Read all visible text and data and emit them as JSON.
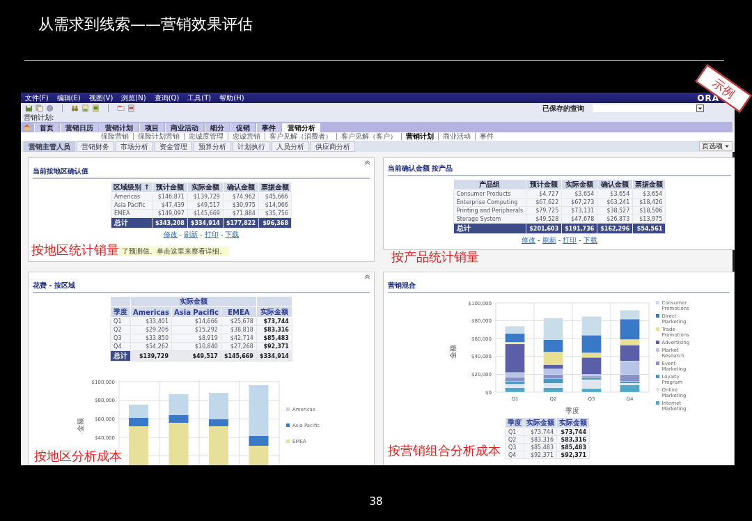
{
  "slide": {
    "title": "从需求到线索——营销效果评估",
    "stamp": "示例",
    "page_number": "38"
  },
  "app": {
    "menu": [
      "文件(F)",
      "编辑(E)",
      "视图(V)",
      "浏览(N)",
      "查询(Q)",
      "工具(T)",
      "帮助(H)"
    ],
    "logo": "ORA",
    "saved_query_label": "已保存的查询",
    "screen_label": "营销计划:",
    "tabs": [
      {
        "label": "首页",
        "selected": false
      },
      {
        "label": "营销日历",
        "selected": false
      },
      {
        "label": "营销计划",
        "selected": false
      },
      {
        "label": "项目",
        "selected": false
      },
      {
        "label": "商业活动",
        "selected": false
      },
      {
        "label": "细分",
        "selected": false
      },
      {
        "label": "促销",
        "selected": false
      },
      {
        "label": "事件",
        "selected": false
      },
      {
        "label": "营销分析",
        "selected": true
      }
    ],
    "subtabs": [
      {
        "label": "保险营销",
        "selected": false
      },
      {
        "label": "保险计划营销",
        "selected": false
      },
      {
        "label": "忠诚度管理",
        "selected": false
      },
      {
        "label": "忠诚营销",
        "selected": false
      },
      {
        "label": "客户见解（消费者）",
        "selected": false
      },
      {
        "label": "客户见解（客户）",
        "selected": false
      },
      {
        "label": "营销计划",
        "selected": true
      },
      {
        "label": "商业活动",
        "selected": false
      },
      {
        "label": "事件",
        "selected": false
      }
    ],
    "view_tabs": [
      {
        "label": "营销主管人员",
        "selected": true
      },
      {
        "label": "营销财务",
        "selected": false
      },
      {
        "label": "市场分析",
        "selected": false
      },
      {
        "label": "资金管理",
        "selected": false
      },
      {
        "label": "预算分析",
        "selected": false
      },
      {
        "label": "计划执行",
        "selected": false
      },
      {
        "label": "人员分析",
        "selected": false
      },
      {
        "label": "供应商分析",
        "selected": false
      }
    ],
    "page_options": "页选项",
    "region_report": {
      "title": "当前按地区确认值",
      "columns": [
        "区域级别 ↑",
        "预计金额",
        "实际金额",
        "确认金额",
        "票据金额"
      ],
      "rows": [
        {
          "kind": "data",
          "cells": [
            "Americas",
            "$146,871",
            "$139,729",
            "$74,962",
            "$45,666"
          ]
        },
        {
          "kind": "data",
          "cells": [
            "Asia Pacific",
            "$47,439",
            "$49,517",
            "$30,975",
            "$14,966"
          ]
        },
        {
          "kind": "data",
          "cells": [
            "EMEA",
            "$149,097",
            "$145,669",
            "$71,884",
            "$35,756"
          ]
        },
        {
          "kind": "total",
          "cells": [
            "总计",
            "$343,208",
            "$334,914",
            "$177,822",
            "$96,368"
          ]
        }
      ],
      "links": [
        "修改",
        "刷新",
        "打印",
        "下载"
      ],
      "link_separator": "-",
      "annotation": "按地区统计销量",
      "note": "了预测值。单击这里来察看详细。"
    },
    "product_report": {
      "title": "当前确认金额 按产品",
      "columns": [
        "产品组",
        "预计金额",
        "实际金额",
        "确认金额",
        "票据金额"
      ],
      "rows": [
        {
          "kind": "data",
          "cells": [
            "Consumer Products",
            "$4,727",
            "$3,654",
            "$3,654",
            "$3,654"
          ]
        },
        {
          "kind": "data",
          "cells": [
            "Enterprise Computing",
            "$67,622",
            "$67,273",
            "$63,241",
            "$18,426"
          ]
        },
        {
          "kind": "data",
          "cells": [
            "Printing and Peripherals",
            "$79,725",
            "$73,131",
            "$38,527",
            "$18,506"
          ]
        },
        {
          "kind": "data",
          "cells": [
            "Storage System",
            "$49,528",
            "$47,678",
            "$26,873",
            "$13,975"
          ]
        },
        {
          "kind": "total",
          "cells": [
            "总计",
            "$201,603",
            "$191,736",
            "$162,296",
            "$54,561"
          ]
        }
      ],
      "links": [
        "修改",
        "刷新",
        "打印",
        "下载"
      ],
      "link_separator": "-",
      "annotation": "按产品统计销量"
    },
    "spend_by_region": {
      "title": "花费 - 按区域",
      "header_group": "实际金额",
      "columns": [
        "季度",
        "Americas",
        "Asia Pacific",
        "EMEA",
        "实际金额"
      ],
      "rows": [
        {
          "kind": "data",
          "cells": [
            "Q1",
            "$33,401",
            "$14,666",
            "$25,678",
            "$73,744"
          ]
        },
        {
          "kind": "data",
          "cells": [
            "Q2",
            "$29,206",
            "$15,292",
            "$38,818",
            "$83,316"
          ]
        },
        {
          "kind": "data",
          "cells": [
            "Q3",
            "$33,850",
            "$8,919",
            "$42,714",
            "$85,483"
          ]
        },
        {
          "kind": "data",
          "cells": [
            "Q4",
            "$54,262",
            "$10,840",
            "$27,268",
            "$92,371"
          ]
        },
        {
          "kind": "total",
          "cells": [
            "总计",
            "$139,729",
            "$49,517",
            "$145,669",
            "$334,914"
          ]
        }
      ],
      "chart": {
        "axis_title": "金额",
        "axis_labels": [
          "$100,000",
          "$80,000",
          "$60,000",
          "$40,000"
        ],
        "legend": [
          {
            "name": "Americas",
            "color": "#c0d8ea"
          },
          {
            "name": "Asia Pacific",
            "color": "#3a78c8"
          },
          {
            "name": "EMEA",
            "color": "#e6e09a"
          }
        ]
      },
      "annotation": "按地区分析成本"
    },
    "marketing_mix": {
      "title": "营销混合",
      "chart_data": {
        "type": "bar",
        "stacked": true,
        "grid": true,
        "legend": true,
        "xlabel": "季度",
        "ylabel": "金额",
        "categories": [
          "Q1",
          "Q2",
          "Q3",
          "Q4"
        ],
        "ylim": [
          0,
          100000
        ],
        "yticks": [
          {
            "value": 0,
            "label": "$0"
          },
          {
            "value": 20000,
            "label": "$20,000"
          },
          {
            "value": 40000,
            "label": "$40,000"
          },
          {
            "value": 60000,
            "label": "$60,000"
          },
          {
            "value": 80000,
            "label": "$80,000"
          },
          {
            "value": 100000,
            "label": "$100,000"
          }
        ],
        "series": [
          {
            "name": "Consumer Promotions",
            "color": "#c8dcea",
            "values": [
              8000,
              24000,
              21000,
              10000
            ]
          },
          {
            "name": "Direct Marketing",
            "color": "#3a78c8",
            "values": [
              10000,
              14000,
              20000,
              23000
            ]
          },
          {
            "name": "Trade Promotions",
            "color": "#e8e090",
            "values": [
              2000,
              14000,
              5000,
              6000
            ]
          },
          {
            "name": "Advertising",
            "color": "#5a5fa8",
            "values": [
              32000,
              5000,
              19000,
              18000
            ]
          },
          {
            "name": "Market Research",
            "color": "#b8c4e8",
            "values": [
              5000,
              6000,
              2000,
              15000
            ]
          },
          {
            "name": "Event Marketing",
            "color": "#8890c8",
            "values": [
              5000,
              5000,
              2000,
              8000
            ]
          },
          {
            "name": "Loyalty Program",
            "color": "#4a98c0",
            "values": [
              3000,
              5000,
              2000,
              2000
            ]
          },
          {
            "name": "Online Marketing",
            "color": "#dde6ee",
            "values": [
              4000,
              5000,
              10000,
              2000
            ]
          },
          {
            "name": "Internet Marketing",
            "color": "#50a8c8",
            "values": [
              5000,
              5000,
              4000,
              8000
            ]
          }
        ]
      },
      "columns": [
        "季度",
        "实际金额",
        "实际金额"
      ],
      "rows": [
        [
          "Q1",
          "$73,744",
          "$73,744"
        ],
        [
          "Q2",
          "$83,316",
          "$83,316"
        ],
        [
          "Q3",
          "$85,483",
          "$85,483"
        ],
        [
          "Q4",
          "$92,371",
          "$92,371"
        ]
      ],
      "annotation": "按营销组合分析成本"
    }
  }
}
